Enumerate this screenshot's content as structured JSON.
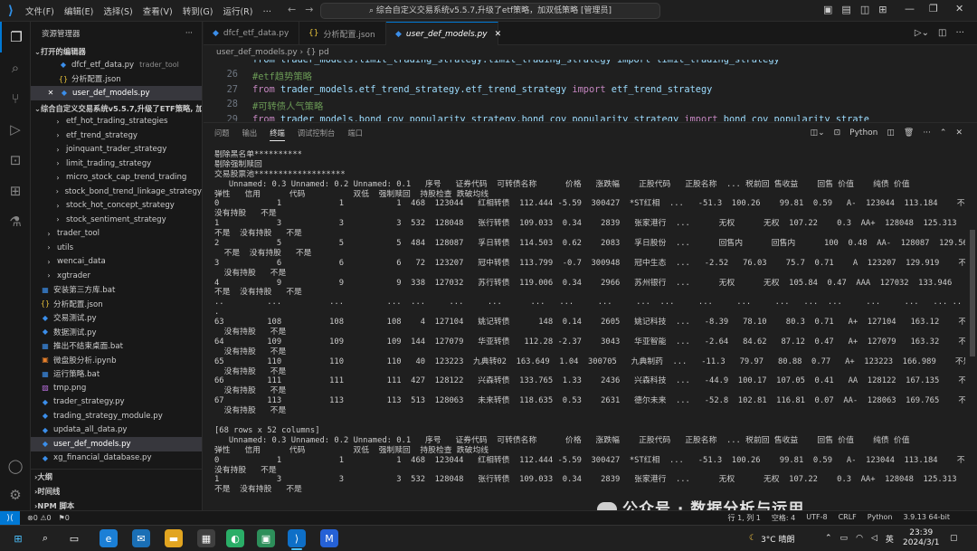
{
  "titlebar": {
    "menus": [
      "文件(F)",
      "编辑(E)",
      "选择(S)",
      "查看(V)",
      "转到(G)",
      "运行(R)",
      "…"
    ],
    "search": "综合自定义交易系统v5.5.7,升级了etf策略，加双低策略 [管理员]"
  },
  "sidebar": {
    "header": "资源管理器",
    "open_editors_label": "打开的编辑器",
    "open_editors": [
      {
        "icon": "python-icon",
        "label": "dfcf_etf_data.py",
        "sub": "trader_tool"
      },
      {
        "icon": "json-icon",
        "label": "分析配置.json",
        "sub": ""
      },
      {
        "icon": "python-icon",
        "label": "user_def_models.py",
        "sub": ""
      }
    ],
    "project_label": "综合自定义交易系统v5.5.7,升级了ETF策略, 加...",
    "tree": [
      {
        "label": "etf_hot_trading_strategies",
        "type": "folder"
      },
      {
        "label": "etf_trend_strategy",
        "type": "folder"
      },
      {
        "label": "joinquant_trader_strategy",
        "type": "folder"
      },
      {
        "label": "limit_trading_strategy",
        "type": "folder"
      },
      {
        "label": "micro_stock_cap_trend_trading",
        "type": "folder"
      },
      {
        "label": "stock_bond_trend_linkage_strategy",
        "type": "folder"
      },
      {
        "label": "stock_hot_concept_strategy",
        "type": "folder"
      },
      {
        "label": "stock_sentiment_strategy",
        "type": "folder"
      },
      {
        "label": "trader_tool",
        "type": "folder0"
      },
      {
        "label": "utils",
        "type": "folder0"
      },
      {
        "label": "wencai_data",
        "type": "folder0"
      },
      {
        "label": "xgtrader",
        "type": "folder0"
      },
      {
        "label": "安装第三方库.bat",
        "type": "bat"
      },
      {
        "label": "分析配置.json",
        "type": "json"
      },
      {
        "label": "交易测试.py",
        "type": "py"
      },
      {
        "label": "数据测试.py",
        "type": "py"
      },
      {
        "label": "推出不结束桌面.bat",
        "type": "bat"
      },
      {
        "label": "微盘股分析.ipynb",
        "type": "nb"
      },
      {
        "label": "运行策略.bat",
        "type": "bat"
      },
      {
        "label": "tmp.png",
        "type": "img"
      },
      {
        "label": "trader_strategy.py",
        "type": "py"
      },
      {
        "label": "trading_strategy_module.py",
        "type": "py"
      },
      {
        "label": "updata_all_data.py",
        "type": "py"
      },
      {
        "label": "user_def_models.py",
        "type": "py",
        "selected": true
      },
      {
        "label": "xg_financial_database.py",
        "type": "py"
      }
    ],
    "bottom_sections": [
      "大纲",
      "时间线",
      "NPM 脚本"
    ]
  },
  "tabs": [
    {
      "label": "dfcf_etf_data.py",
      "icon": "python-icon",
      "active": false
    },
    {
      "label": "分析配置.json",
      "icon": "json-icon",
      "active": false
    },
    {
      "label": "user_def_models.py",
      "icon": "python-icon",
      "active": true
    }
  ],
  "breadcrumb": "user_def_models.py  ›  {} pd",
  "editor_lines": [
    {
      "n": "",
      "parts": [
        {
          "c": "tx",
          "t": "from trader_models.limit_trading_strategy.limit_trading_strategy import limit_trading_strategy"
        }
      ]
    },
    {
      "n": "26",
      "parts": [
        {
          "c": "cm",
          "t": "#etf趋势策略"
        }
      ]
    },
    {
      "n": "27",
      "parts": [
        {
          "c": "kw",
          "t": "from "
        },
        {
          "c": "tx",
          "t": "trader_models.etf_trend_strategy.etf_trend_strategy "
        },
        {
          "c": "kw",
          "t": "import "
        },
        {
          "c": "tx",
          "t": "etf_trend_strategy"
        }
      ]
    },
    {
      "n": "28",
      "parts": [
        {
          "c": "cm",
          "t": "#可转债人气策略"
        }
      ]
    },
    {
      "n": "29",
      "parts": [
        {
          "c": "kw",
          "t": "from "
        },
        {
          "c": "tx",
          "t": "trader_models.bond_cov_popularity_strategy.bond_cov_popularity_strategy "
        },
        {
          "c": "kw",
          "t": "import "
        },
        {
          "c": "tx",
          "t": "bond_cov_popularity_strate"
        }
      ]
    }
  ],
  "panel": {
    "tabs": [
      "问题",
      "输出",
      "终端",
      "调试控制台",
      "端口"
    ],
    "active_tab": "终端",
    "shell": "Python",
    "terminal_lines": [
      "剔除黑名单**********",
      "剔除强制赎回",
      "交易股票池*******************",
      "   Unnamed: 0.3 Unnamed: 0.2 Unnamed: 0.1   序号   证券代码  可转债名称      价格   涨跌幅    正股代码   正股名称  ... 税前回 售收益    回售 价值    纯债 价值",
      "弹性   信用      代码          双低  强制赎回  持股检查 跌破均线",
      "0            1            1           1  468  123044   红相转债  112.444 -5.59  300427  *ST红相  ...   -51.3  100.26    99.81  0.59   A-  123044  113.184    不是",
      "没有持股   不是",
      "1            3            3           3  532  128048   张行转债  109.033  0.34    2839   张家港行  ...      无权      无权  107.22    0.3  AA+  128048  125.313",
      "不是  没有持股   不是",
      "2            5            5           5  484  128087   孚日转债  114.503  0.62    2083   孚日股份  ...      回售内      回售内      100  0.48  AA-  128087  129.563",
      "  不是  没有持股   不是",
      "3            6            6           6   72  123207   冠中转债  113.799  -0.7  300948   冠中生态  ...   -2.52   76.03    75.7  0.71    A  123207  129.919    不是",
      "  没有持股   不是",
      "4            9            9           9  338  127032   苏行转债  119.006  0.34    2966   苏州银行  ...      无权      无权  105.84  0.47  AAA  127032  133.946",
      "不是  没有持股   不是",
      "..         ...          ...         ...  ...     ...     ...      ...   ...     ...     ...  ...     ...     ...     ...   ...  ...     ...     ...   ... ..",
      ".",
      "63         108          108         108    4  127104   姚记转债      148  0.14    2605   姚记科技  ...   -8.39   78.10    80.3  0.71   A+  127104   163.12    不是",
      "  没有持股   不是",
      "64         109          109         109  144  127079   华亚转债   112.28 -2.37    3043   华亚智能  ...   -2.64   84.62   87.12  0.47   A+  127079   163.32    不是",
      "  没有持股   不是",
      "65         110          110         110   40  123223  九典转02  163.649  1.04  300705   九典制药  ...   -11.3   79.97   80.88  0.77   A+  123223  166.989    不是",
      "  没有持股   不是",
      "66         111          111         111  427  128122   兴森转债  133.765  1.33    2436   兴森科技  ...   -44.9  100.17  107.05  0.41   AA  128122  167.135    不是",
      "  没有持股   不是",
      "67         113          113         113  513  128063   未来转债  118.635  0.53    2631   德尔未来  ...   -52.8  102.81  116.81  0.07  AA-  128063  169.765    不是",
      "  没有持股   不是",
      "",
      "[68 rows x 52 columns]",
      "   Unnamed: 0.3 Unnamed: 0.2 Unnamed: 0.1   序号   证券代码  可转债名称      价格   涨跌幅    正股代码   正股名称  ... 税前回 售收益    回售 价值    纯债 价值",
      "弹性   信用      代码          双低  强制赎回  持股检查 跌破均线",
      "0            1            1           1  468  123044   红相转债  112.444 -5.59  300427  *ST红相  ...   -51.3  100.26    99.81  0.59   A-  123044  113.184    不是",
      "没有持股   不是",
      "1            3            3           3  532  128048   张行转债  109.033  0.34    2839   张家港行  ...      无权      无权  107.22    0.3  AA+  128048  125.313",
      "不是  没有持股   不是"
    ]
  },
  "watermark": "公众号 · 数据分析与运用",
  "status": {
    "errors": "0",
    "warnings": "0",
    "info": "0",
    "position": "行 1, 列 1",
    "spaces": "空格: 4",
    "encoding": "UTF-8",
    "eol": "CRLF",
    "lang": "Python",
    "version": "3.9.13 64-bit"
  },
  "taskbar": {
    "weather": "3°C  晴朗",
    "ime": "英",
    "time": "23:39",
    "date": "2024/3/1"
  }
}
